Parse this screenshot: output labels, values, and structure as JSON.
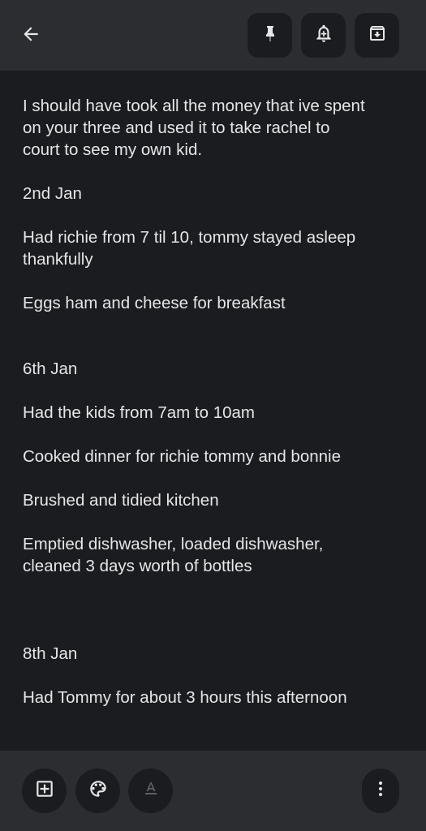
{
  "toolbar": {
    "back_icon": "arrow-back-icon",
    "pin_icon": "pin-icon",
    "reminder_icon": "add-reminder-bell-icon",
    "archive_icon": "archive-icon"
  },
  "note": {
    "lines": [
      "I should have took all the money that ive spent",
      "on your three and used it to take rachel to",
      "court to see my own kid.",
      "",
      "2nd Jan",
      "",
      "Had richie from 7 til 10, tommy stayed asleep",
      "thankfully",
      "",
      "Eggs ham and cheese for breakfast",
      "",
      "",
      "6th Jan",
      "",
      "Had the kids from 7am to 10am",
      "",
      "Cooked dinner for richie tommy and bonnie",
      "",
      "Brushed and tidied kitchen",
      "",
      "Emptied dishwasher, loaded dishwasher,",
      "cleaned 3 days worth of bottles",
      "",
      "",
      "",
      "8th Jan",
      "",
      "Had Tommy for about 3 hours this afternoon"
    ]
  },
  "bottombar": {
    "add_icon": "add-box-icon",
    "palette_icon": "palette-icon",
    "text_format_icon": "text-format-icon",
    "more_icon": "more-vert-icon"
  },
  "colors": {
    "bar_bg": "#2c2d30",
    "page_bg": "#1b1c1f",
    "text": "#e6e6e8"
  }
}
